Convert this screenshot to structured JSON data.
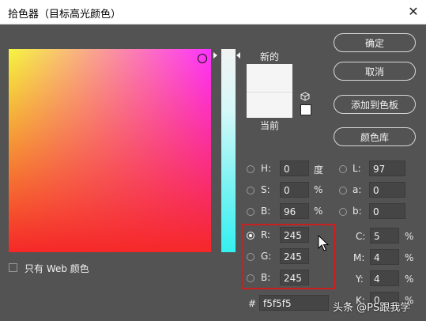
{
  "window": {
    "title": "拾色器（目标高光颜色）",
    "close_icon": "close-icon"
  },
  "preview": {
    "new_label": "新的",
    "current_label": "当前",
    "new_color": "#f5f5f5",
    "current_color": "#f5f5f5"
  },
  "buttons": {
    "ok": "确定",
    "cancel": "取消",
    "add_swatch": "添加到色板",
    "color_libraries": "颜色库"
  },
  "hsb": {
    "h": {
      "label": "H:",
      "value": "0",
      "unit": "度"
    },
    "s": {
      "label": "S:",
      "value": "0",
      "unit": "%"
    },
    "b": {
      "label": "B:",
      "value": "96",
      "unit": "%"
    }
  },
  "rgb": {
    "r": {
      "label": "R:",
      "value": "245"
    },
    "g": {
      "label": "G:",
      "value": "245"
    },
    "b": {
      "label": "B:",
      "value": "245"
    }
  },
  "lab": {
    "l": {
      "label": "L:",
      "value": "97"
    },
    "a": {
      "label": "a:",
      "value": "0"
    },
    "b": {
      "label": "b:",
      "value": "0"
    }
  },
  "cmyk": {
    "c": {
      "label": "C:",
      "value": "5",
      "unit": "%"
    },
    "m": {
      "label": "M:",
      "value": "4",
      "unit": "%"
    },
    "y": {
      "label": "Y:",
      "value": "4",
      "unit": "%"
    },
    "k": {
      "label": "K:",
      "value": "0",
      "unit": "%"
    }
  },
  "hex": {
    "label": "#",
    "value": "f5f5f5"
  },
  "web_only": {
    "label": "只有 Web 颜色",
    "checked": false
  },
  "watermark": "头条 @PS跟我学",
  "colors": {
    "highlight_box": "#c82020",
    "dialog_bg": "#535353"
  }
}
